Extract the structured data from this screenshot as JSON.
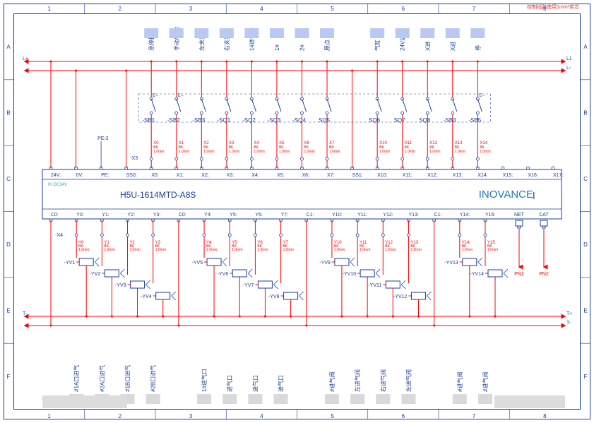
{
  "meta": {
    "note_top_right": "控制线路使用1mm²单芯"
  },
  "grid": {
    "cols": [
      "1",
      "2",
      "3",
      "4",
      "5",
      "6",
      "7",
      "8"
    ],
    "rows": [
      "A",
      "B",
      "C",
      "D",
      "E",
      "F"
    ]
  },
  "rails": {
    "top_left": "L+",
    "bottom_left": "T-"
  },
  "plc": {
    "model": "H5U-1614MTD-A8S",
    "brand": "INOVANCE",
    "power_note": "IN DC24V",
    "top_ports": [
      "24V:",
      "0V:",
      "PE:",
      "SS0:",
      "X0:",
      "X1:",
      "X2:",
      "X3:",
      "X4:",
      "X5:",
      "X6:",
      "X7:",
      "SS1:",
      "X10:",
      "X11:",
      "X12:",
      "X13:",
      "X14:",
      "X15:",
      "X16:",
      "X17:"
    ],
    "bot_ports": [
      "C0:",
      "Y0:",
      "Y1:",
      "Y2:",
      "Y3:",
      "C0:",
      "Y4:",
      "Y5:",
      "Y6:",
      "Y7:",
      "C1:",
      "Y10:",
      "Y11:",
      "Y12:",
      "Y13:",
      "C1:",
      "Y14:",
      "Y15:"
    ],
    "net_ports": [
      "NET",
      "CAT"
    ],
    "pn_ports": [
      "PN1",
      "PN2"
    ]
  },
  "inputs": {
    "pe": "PE:3",
    "x3_tag": "-X3",
    "switches": [
      {
        "ref": "-SB1",
        "type": "push-e",
        "top_label": "急停按钮"
      },
      {
        "ref": "-SB2",
        "type": "sel-e",
        "top_label": "手动/自动"
      },
      {
        "ref": "-SB3",
        "type": "push",
        "top_label": "左夹紧"
      },
      {
        "ref": "-SQ1",
        "type": "push",
        "top_label": "右夹紧"
      },
      {
        "ref": "-SQ2",
        "type": "push",
        "top_label": "1#进气阀"
      },
      {
        "ref": "-SQ3",
        "type": "push",
        "top_label": "1#"
      },
      {
        "ref": "-SQ4",
        "type": "push",
        "top_label": "2#"
      },
      {
        "ref": "SQ5",
        "type": "push",
        "top_label": "原点"
      },
      {
        "ref": "SQ6",
        "type": "push",
        "top_label": "气缸"
      },
      {
        "ref": "SQ7",
        "type": "push",
        "top_label": "24V进"
      },
      {
        "ref": "SQ8",
        "type": "push",
        "top_label": "X进"
      },
      {
        "ref": "-SB4",
        "type": "push",
        "top_label": "X进"
      },
      {
        "ref": "-SB5",
        "type": "push-e",
        "top_label": "停"
      }
    ],
    "wires": [
      {
        "tag": "X0",
        "color": "BK",
        "size": "1.0mm"
      },
      {
        "tag": "X1",
        "color": "BK",
        "size": "1.0mm"
      },
      {
        "tag": "X2",
        "color": "BK",
        "size": "1.0mm"
      },
      {
        "tag": "X3",
        "color": "BK",
        "size": "1.0mm"
      },
      {
        "tag": "X4",
        "color": "BK",
        "size": "1.0mm"
      },
      {
        "tag": "X5",
        "color": "BK",
        "size": "1.0mm"
      },
      {
        "tag": "X6",
        "color": "BK",
        "size": "1.0mm"
      },
      {
        "tag": "X7",
        "color": "BK",
        "size": "1.0mm"
      },
      {
        "tag": "X10",
        "color": "BK",
        "size": "1.0mm"
      },
      {
        "tag": "X11",
        "color": "BK",
        "size": "1.0mm"
      },
      {
        "tag": "X12",
        "color": "BK",
        "size": "1.0mm"
      },
      {
        "tag": "X13",
        "color": "BK",
        "size": "1.0mm"
      },
      {
        "tag": "X14",
        "color": "BK",
        "size": "1.0mm"
      }
    ]
  },
  "outputs": {
    "x4_tag": "-X4",
    "wires": [
      {
        "tag": "Y0",
        "color": "BK",
        "size": "1.0mm"
      },
      {
        "tag": "Y1",
        "color": "BK",
        "size": "1.0mm"
      },
      {
        "tag": "Y2",
        "color": "BK",
        "size": "1.0mm"
      },
      {
        "tag": "Y3",
        "color": "BK",
        "size": "1.0mm"
      },
      {
        "tag": "Y4",
        "color": "BK",
        "size": "1.0mm"
      },
      {
        "tag": "Y5",
        "color": "BK",
        "size": "1.0mm"
      },
      {
        "tag": "Y6",
        "color": "BK",
        "size": "1.0mm"
      },
      {
        "tag": "Y7",
        "color": "BK",
        "size": "1.0mm"
      },
      {
        "tag": "Y10",
        "color": "BK",
        "size": "1.0mm"
      },
      {
        "tag": "Y11",
        "color": "BK",
        "size": "1.0mm"
      },
      {
        "tag": "Y12",
        "color": "BK",
        "size": "1.0mm"
      },
      {
        "tag": "Y13",
        "color": "BK",
        "size": "1.0mm"
      },
      {
        "tag": "Y14",
        "color": "BK",
        "size": "1.0mm"
      },
      {
        "tag": "Y15",
        "color": "BK",
        "size": "1.0mm"
      }
    ],
    "valves": [
      {
        "ref": "-YV1",
        "bot_label": "#1A口进气"
      },
      {
        "ref": "-YV2",
        "bot_label": "#2A口进气"
      },
      {
        "ref": "-YV3",
        "bot_label": "#1B口进气"
      },
      {
        "ref": "-YV4",
        "bot_label": "#2B口进气"
      },
      {
        "ref": "-YV5",
        "bot_label": "1#进气口"
      },
      {
        "ref": "-YV6",
        "bot_label": "进气口"
      },
      {
        "ref": "-YV7",
        "bot_label": "进气口"
      },
      {
        "ref": "-YV8",
        "bot_label": "进气口"
      },
      {
        "ref": "-YV9",
        "bot_label": "#进气阀"
      },
      {
        "ref": "-YV10",
        "bot_label": "左进气阀"
      },
      {
        "ref": "-YV11",
        "bot_label": "右进气阀"
      },
      {
        "ref": "-YV12",
        "bot_label": "左进气阀"
      },
      {
        "ref": "-YV13",
        "bot_label": "#进气阀"
      },
      {
        "ref": "-YV14",
        "bot_label": "#进气阀"
      }
    ]
  },
  "colors": {
    "wire": "#f00",
    "ink": "#1a3d9c",
    "brand": "#1e7ac0"
  }
}
